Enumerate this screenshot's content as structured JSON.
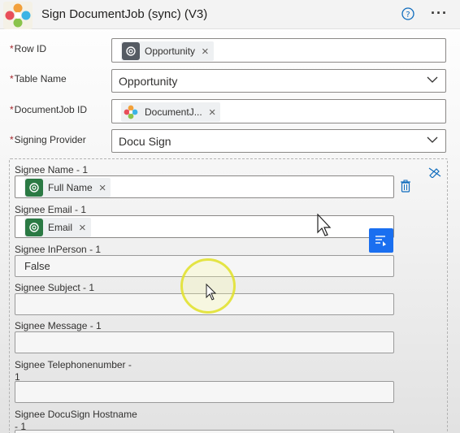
{
  "header": {
    "title": "Sign DocumentJob (sync) (V3)",
    "help_icon": "question-circle-icon",
    "more_label": "···"
  },
  "fields": {
    "row_id": {
      "label": "Row ID",
      "token": "Opportunity"
    },
    "table_name": {
      "label": "Table Name",
      "value": "Opportunity"
    },
    "documentjob_id": {
      "label": "DocumentJob ID",
      "token": "DocumentJ..."
    },
    "signing_provider": {
      "label": "Signing Provider",
      "value": "Docu Sign"
    }
  },
  "signee": {
    "name": {
      "label": "Signee Name - 1",
      "token": "Full Name"
    },
    "email": {
      "label": "Signee Email - 1",
      "token": "Email"
    },
    "in_person": {
      "label": "Signee InPerson - 1",
      "value": "False"
    },
    "subject": {
      "label": "Signee Subject - 1",
      "value": ""
    },
    "message": {
      "label": "Signee Message - 1",
      "value": ""
    },
    "telephone": {
      "label_line1": "Signee Telephonenumber -",
      "label_line2": "1",
      "value": ""
    },
    "hostname": {
      "label_line1": "Signee DocuSign Hostname",
      "label_line2": "- 1"
    }
  },
  "required_marker": "*",
  "token_remove": "×",
  "colors": {
    "required": "#a4262c",
    "accent": "#1a6ff0",
    "dataverse_green": "#2b7a44",
    "highlight": "#e1e128"
  }
}
